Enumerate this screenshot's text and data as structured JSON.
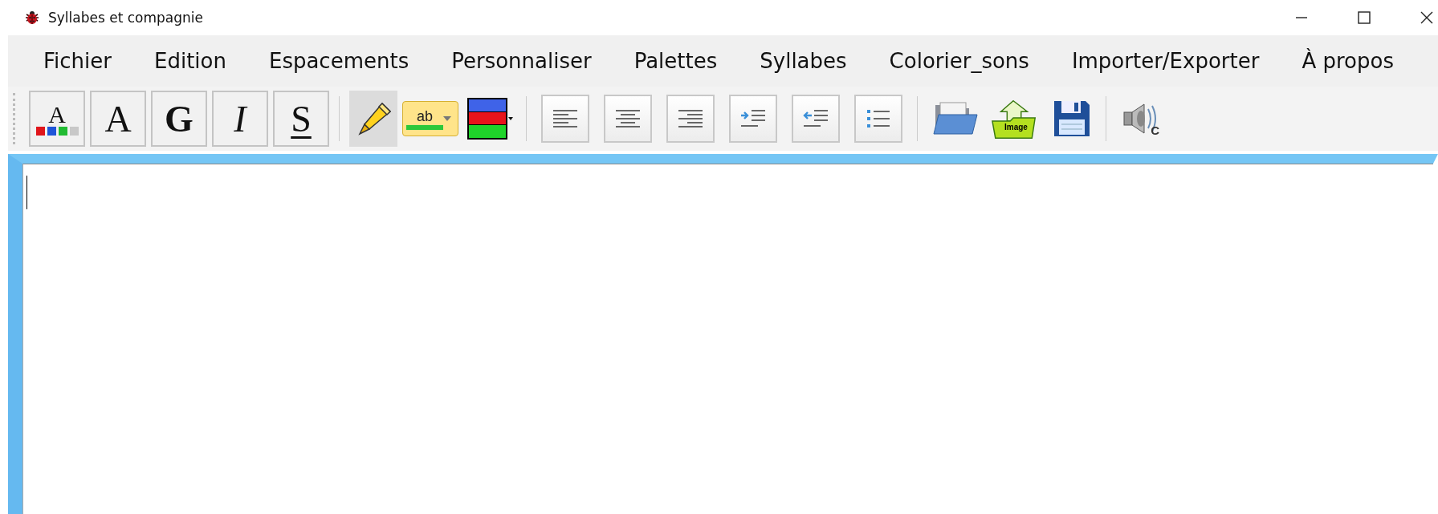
{
  "window": {
    "title": "Syllabes et compagnie"
  },
  "menu": [
    "Fichier",
    "Edition",
    "Espacements",
    "Personnaliser",
    "Palettes",
    "Syllabes",
    "Colorier_sons",
    "Importer/Exporter",
    "À propos"
  ],
  "toolbar": [
    {
      "kind": "fontcolor",
      "label": "A",
      "pressed": false
    },
    {
      "kind": "plain",
      "label": "A",
      "pressed": false
    },
    {
      "kind": "bold",
      "label": "G",
      "pressed": false
    },
    {
      "kind": "italic",
      "label": "I",
      "pressed": false
    },
    {
      "kind": "underline",
      "label": "S",
      "pressed": false
    },
    {
      "kind": "separator"
    },
    {
      "kind": "highlighter",
      "pressed": true
    },
    {
      "kind": "highlightcolor",
      "label": "ab",
      "pressed": false
    },
    {
      "kind": "palette",
      "pressed": false
    },
    {
      "kind": "separator"
    },
    {
      "kind": "alignleft",
      "pressed": false
    },
    {
      "kind": "aligncenter",
      "pressed": false
    },
    {
      "kind": "alignright",
      "pressed": false
    },
    {
      "kind": "indent",
      "pressed": false
    },
    {
      "kind": "outdent",
      "pressed": false
    },
    {
      "kind": "bullets",
      "pressed": false
    },
    {
      "kind": "separator"
    },
    {
      "kind": "folder",
      "pressed": false
    },
    {
      "kind": "imagefolder",
      "label": "Image",
      "pressed": false
    },
    {
      "kind": "floppy",
      "pressed": false
    },
    {
      "kind": "separator"
    },
    {
      "kind": "speaker",
      "label": "C",
      "pressed": false
    }
  ]
}
